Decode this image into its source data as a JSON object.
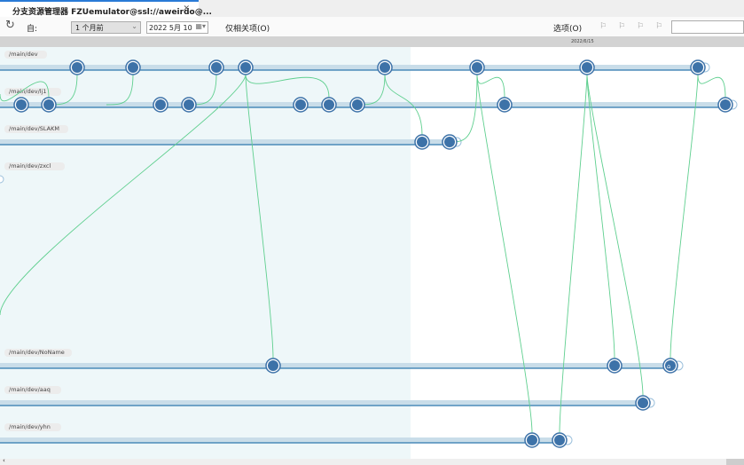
{
  "tab": {
    "title": "分支资源管理器 FZUemulator@ssl://aweirdo@...",
    "close": "✕"
  },
  "toolbar": {
    "from_label": "自:",
    "range": "1 个月前",
    "date": "2022  5月  10",
    "only_related": "仅相关项(O)",
    "options": "选项(O)"
  },
  "ruler": {
    "date": "2022/6/15"
  },
  "branches": [
    {
      "name": "/main/dev"
    },
    {
      "name": "/main/dev/lj1"
    },
    {
      "name": "/main/dev/SLAKM"
    },
    {
      "name": "/main/dev/zxcl"
    },
    {
      "name": "/main/dev/NoName"
    },
    {
      "name": "/main/dev/aaq"
    },
    {
      "name": "/main/dev/yhn"
    }
  ],
  "colors": {
    "node": "#3d72a8",
    "link": "#5fcf8f",
    "shade": "#eef7f9"
  }
}
